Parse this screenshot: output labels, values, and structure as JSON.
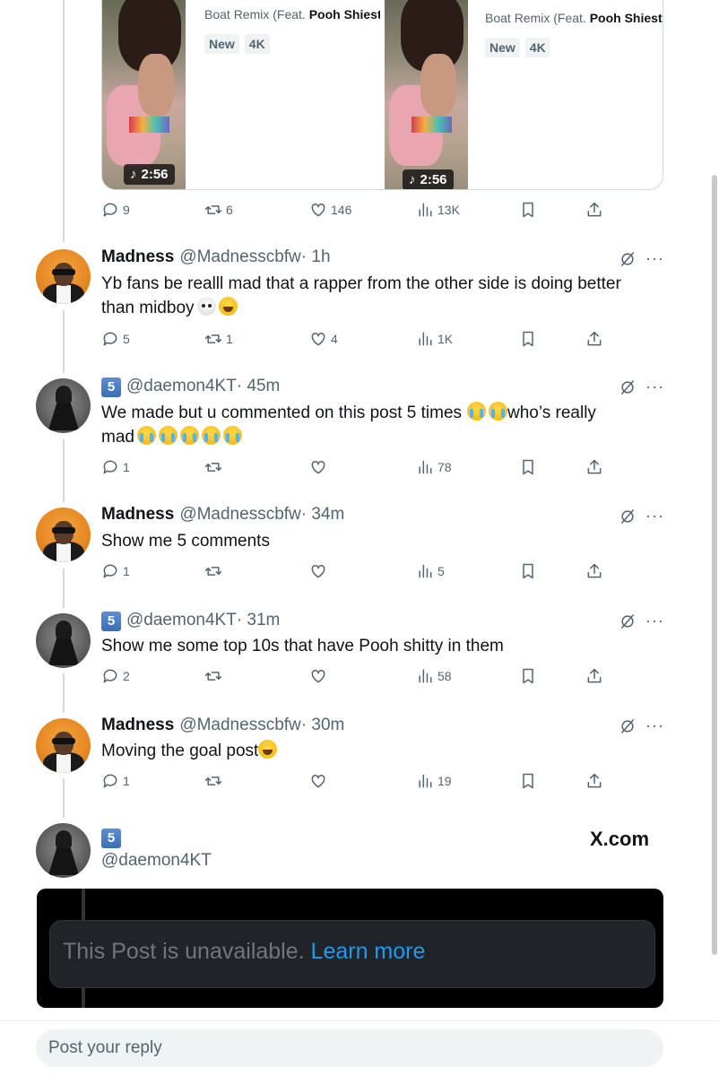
{
  "media": [
    {
      "duration": "2:56",
      "title_prefix": "Boat Remix (Feat. ",
      "title_bold": "Pooh Shiesty",
      "tags": [
        "New",
        "4K"
      ]
    },
    {
      "duration": "2:56",
      "title_prefix": "Boat Remix (Feat. ",
      "title_bold": "Pooh Shiesty",
      "tags": [
        "New",
        "4K"
      ]
    }
  ],
  "top_actions": {
    "replies": "9",
    "reposts": "6",
    "likes": "146",
    "views": "13K"
  },
  "tweets": [
    {
      "name": "Madness",
      "handle": "@Madnesscbfw",
      "time": "· 1h",
      "line1": "Yb fans be realll mad that a rapper from the other side is doing better",
      "line2": "than midboy",
      "replies": "5",
      "reposts": "1",
      "likes": "4",
      "views": "1K"
    },
    {
      "name": "5",
      "handle": "@daemon4KT",
      "time": "· 45m",
      "line1": "We made but u commented on this post 5 times",
      "line1b": "who’s really",
      "line2": "mad",
      "replies": "1",
      "reposts": "",
      "likes": "",
      "views": "78"
    },
    {
      "name": "Madness",
      "handle": "@Madnesscbfw",
      "time": "· 34m",
      "line1": "Show me 5 comments",
      "replies": "1",
      "reposts": "",
      "likes": "",
      "views": "5"
    },
    {
      "name": "5",
      "handle": "@daemon4KT",
      "time": "· 31m",
      "line1": "Show me some top 10s that have Pooh shitty in them",
      "replies": "2",
      "reposts": "",
      "likes": "",
      "views": "58"
    },
    {
      "name": "Madness",
      "handle": "@Madnesscbfw",
      "time": "· 30m",
      "line1": "Moving the goal post",
      "replies": "1",
      "reposts": "",
      "likes": "",
      "views": "19"
    }
  ],
  "last": {
    "badge": "5",
    "handle": "@daemon4KT",
    "watermark": "X.com"
  },
  "embed": {
    "message": "This Post is unavailable.",
    "link": "Learn more"
  },
  "reply": {
    "placeholder": "Post your reply"
  },
  "icons": {
    "reply": "reply-icon",
    "repost": "repost-icon",
    "like": "heart-icon",
    "views": "views-icon",
    "bookmark": "bookmark-icon",
    "share": "share-icon",
    "grok": "grok-icon",
    "more": "more-icon",
    "music": "music-note-icon"
  }
}
